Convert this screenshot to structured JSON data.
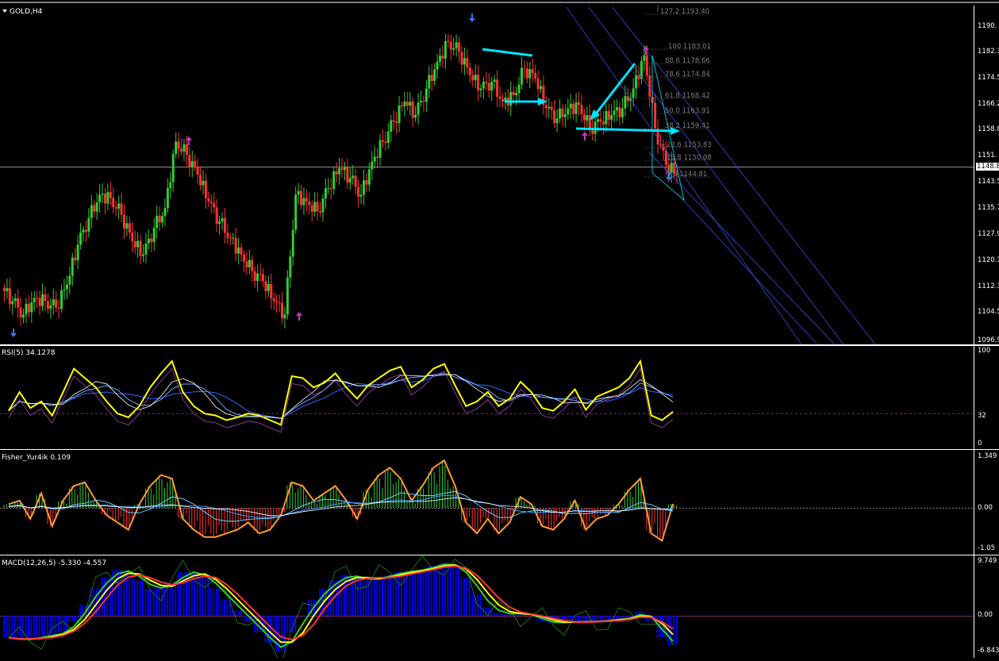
{
  "chart_title": "GOLD,H4",
  "colors": {
    "bull": "#33cc33",
    "bear": "#ff3333",
    "rsi": "#ffff00",
    "fisher_pos": "#33cc33",
    "fisher_neg": "#ff3333",
    "fisher_line": "#ff9933",
    "macd_hist": "#0000ee",
    "channel": "#3344cc",
    "arrow_cyan": "#00e5ff",
    "fractal_up": "#3377ff",
    "fractal_down": "#cc33cc"
  },
  "main": {
    "current_price": "1148.8",
    "axis_ticks": [
      "1190.",
      "1182.3",
      "1174.5",
      "1166.2",
      "1158.8",
      "1151.",
      "1143.5",
      "1135.7",
      "1127.9",
      "1120.1",
      "1112.3",
      "1104.5",
      "1096.9"
    ],
    "fib_levels": [
      {
        "text": "127.2  1193.40"
      },
      {
        "text": "100  1183.01"
      },
      {
        "text": "88.6  1178.66"
      },
      {
        "text": "78.6  1174.84"
      },
      {
        "text": "61.8  1168.42"
      },
      {
        "text": "50.0  1163.91"
      },
      {
        "text": "38.2  1159.41"
      },
      {
        "text": "23.6  1153.83"
      },
      {
        "text": "13.8  1150.08"
      },
      {
        "text": "0.0  1144.81"
      }
    ]
  },
  "rsi": {
    "label": "RSI(5) 34.1278",
    "ticks": [
      "100",
      "32",
      "0"
    ]
  },
  "fisher": {
    "label": "Fisher_Yur4ik 0.109",
    "ticks": [
      "1.349",
      "0.00",
      "-1.05"
    ]
  },
  "macd": {
    "label": "MACD(12,26,5) -5.330 -4.557",
    "ticks": [
      "9.749",
      "0.00",
      "-6.843"
    ]
  },
  "chart_data": [
    {
      "type": "candlestick",
      "title": "GOLD,H4",
      "ylim": [
        1096.9,
        1193.5
      ],
      "series": [
        {
          "name": "close",
          "values": [
            1108,
            1104,
            1109,
            1108,
            1106,
            1113,
            1125,
            1133,
            1140,
            1139,
            1134,
            1126,
            1122,
            1130,
            1136,
            1156,
            1152,
            1146,
            1138,
            1132,
            1127,
            1122,
            1117,
            1114,
            1108,
            1104,
            1140,
            1138,
            1135,
            1142,
            1148,
            1145,
            1140,
            1150,
            1156,
            1162,
            1168,
            1164,
            1172,
            1180,
            1186,
            1183,
            1176,
            1172,
            1174,
            1168,
            1170,
            1178,
            1175,
            1166,
            1163,
            1166,
            1167,
            1160,
            1162,
            1164,
            1166,
            1172,
            1182,
            1160,
            1149,
            1146
          ]
        }
      ]
    },
    {
      "type": "line",
      "title": "RSI(5) 34.1278",
      "ylim": [
        0,
        100
      ],
      "series": [
        {
          "name": "RSI",
          "values": [
            35,
            55,
            38,
            45,
            30,
            55,
            80,
            70,
            60,
            45,
            32,
            28,
            40,
            60,
            75,
            88,
            55,
            40,
            32,
            30,
            25,
            28,
            32,
            30,
            25,
            20,
            72,
            70,
            60,
            65,
            75,
            60,
            48,
            62,
            70,
            78,
            82,
            60,
            68,
            80,
            85,
            62,
            40,
            45,
            55,
            40,
            48,
            66,
            55,
            38,
            35,
            45,
            58,
            36,
            50,
            55,
            60,
            70,
            88,
            30,
            25,
            34
          ]
        }
      ]
    },
    {
      "type": "bar",
      "title": "Fisher_Yur4ik 0.109",
      "ylim": [
        -1.05,
        1.349
      ],
      "series": [
        {
          "name": "Fisher",
          "values": [
            0.1,
            0.2,
            -0.3,
            0.4,
            -0.5,
            0.2,
            0.6,
            0.7,
            0.2,
            -0.2,
            -0.4,
            -0.6,
            0.1,
            0.6,
            0.9,
            0.8,
            -0.3,
            -0.6,
            -0.8,
            -0.8,
            -0.7,
            -0.6,
            -0.4,
            -0.7,
            -0.6,
            -0.2,
            0.7,
            0.6,
            0.2,
            0.4,
            0.6,
            0.2,
            -0.3,
            0.5,
            0.9,
            1.1,
            0.8,
            0.2,
            0.6,
            1.1,
            1.3,
            0.6,
            -0.4,
            -0.7,
            -0.3,
            -0.7,
            -0.4,
            0.3,
            0.1,
            -0.5,
            -0.6,
            -0.3,
            0.2,
            -0.6,
            -0.3,
            -0.2,
            0.1,
            0.5,
            0.8,
            -0.7,
            -0.9,
            0.109
          ]
        }
      ]
    },
    {
      "type": "bar",
      "title": "MACD(12,26,5) -5.330 -4.557",
      "ylim": [
        -6.843,
        9.749
      ],
      "series": [
        {
          "name": "MACD",
          "values": [
            -4,
            -4.5,
            -4.2,
            -3.8,
            -3.5,
            -3,
            -1,
            2,
            5,
            7,
            8.4,
            8,
            6.5,
            5,
            5.2,
            6,
            8,
            8,
            7,
            5,
            3,
            1,
            -1,
            -3,
            -5,
            -6.5,
            -3,
            0,
            3,
            5,
            6.5,
            7.5,
            7,
            6.5,
            7,
            7.5,
            8,
            8.2,
            8.5,
            9.2,
            9.7,
            9,
            7,
            4,
            1.5,
            0.5,
            0.3,
            0.5,
            0,
            -1,
            -1.3,
            -1.2,
            -1,
            -1.2,
            -1,
            -0.8,
            -0.6,
            -0.4,
            0.8,
            -1,
            -4,
            -5.33
          ]
        }
      ]
    }
  ]
}
